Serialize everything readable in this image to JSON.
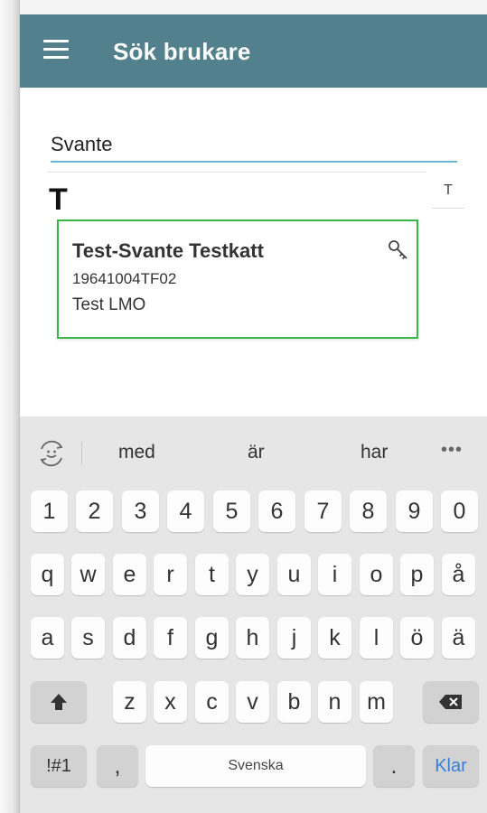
{
  "toolbar": {
    "title": "Sök brukare",
    "menu_icon": "hamburger-menu-icon"
  },
  "search": {
    "value": "Svante"
  },
  "results": {
    "section_letter": "T",
    "index_letter": "T",
    "items": [
      {
        "name": "Test-Svante Testkatt",
        "id": "19641004TF02",
        "org": "Test LMO",
        "icon": "key-icon"
      }
    ]
  },
  "keyboard": {
    "suggestions": [
      "med",
      "är",
      "har"
    ],
    "emoji_icon": "emoji-toggle-icon",
    "more_icon": "more-dots-icon",
    "row_numbers": [
      "1",
      "2",
      "3",
      "4",
      "5",
      "6",
      "7",
      "8",
      "9",
      "0"
    ],
    "row1": [
      "q",
      "w",
      "e",
      "r",
      "t",
      "y",
      "u",
      "i",
      "o",
      "p",
      "å"
    ],
    "row2": [
      "a",
      "s",
      "d",
      "f",
      "g",
      "h",
      "j",
      "k",
      "l",
      "ö",
      "ä"
    ],
    "row3": [
      "z",
      "x",
      "c",
      "v",
      "b",
      "n",
      "m"
    ],
    "shift_icon": "shift-icon",
    "backspace_icon": "backspace-icon",
    "symbols_label": "!#1",
    "comma_label": ",",
    "space_label": "Svenska",
    "period_label": ".",
    "done_label": "Klar"
  },
  "colors": {
    "toolbar": "#52808d",
    "accent_underline": "#6cb7d4",
    "card_border": "#39b54a",
    "done": "#3a7fd4"
  }
}
